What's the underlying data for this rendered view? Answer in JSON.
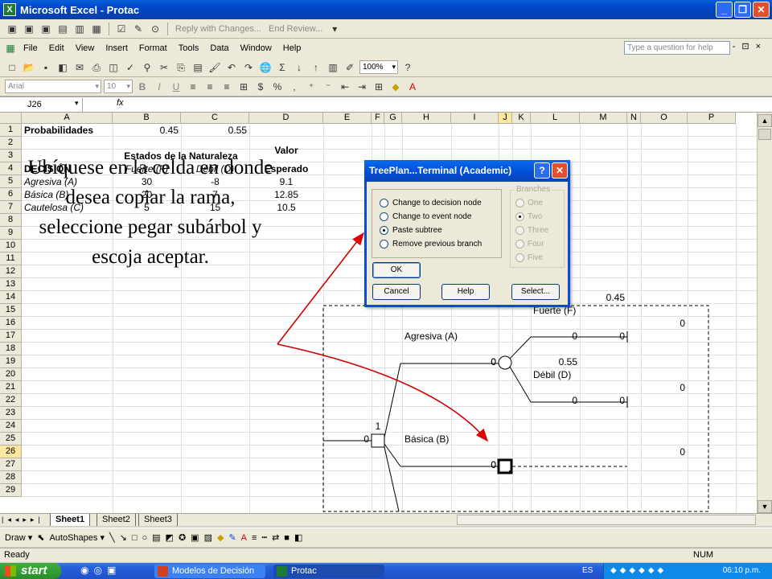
{
  "window": {
    "title": "Microsoft Excel - Protac"
  },
  "reviewing_toolbar": {
    "reply_label": "Reply with Changes...",
    "end_review_label": "End Review..."
  },
  "menu": {
    "items": [
      "File",
      "Edit",
      "View",
      "Insert",
      "Format",
      "Tools",
      "Data",
      "Window",
      "Help"
    ],
    "help_placeholder": "Type a question for help"
  },
  "standard_toolbar": {
    "zoom": "100%"
  },
  "formatting_toolbar": {
    "font": "Arial",
    "size": "10"
  },
  "formula_bar": {
    "name_box": "J26",
    "fx": "fx"
  },
  "columns": [
    "A",
    "B",
    "C",
    "D",
    "E",
    "F",
    "G",
    "H",
    "I",
    "J",
    "K",
    "L",
    "M",
    "N",
    "O",
    "P"
  ],
  "rows": [
    "1",
    "2",
    "3",
    "4",
    "5",
    "6",
    "7",
    "8",
    "9",
    "10",
    "11",
    "12",
    "13",
    "14",
    "15",
    "16",
    "17",
    "18",
    "19",
    "20",
    "21",
    "22",
    "23",
    "24",
    "25",
    "26",
    "27",
    "28",
    "29"
  ],
  "cells": {
    "a1": "Probabilidades",
    "b1": "0.45",
    "c1": "0.55",
    "b3": "Estados de la Naturaleza",
    "d3": "Valor",
    "d4": "Esperado",
    "a4": "DECISIÓN",
    "b4": "Fuerte (F)",
    "c4": "Débil (D)",
    "a5": "Agresiva (A)",
    "b5": "30",
    "c5": "-8",
    "d5": "9.1",
    "a6": "Básica (B)",
    "b6": "20",
    "c6": "7",
    "d6": "12.85",
    "a7": "Cautelosa (C)",
    "b7": "5",
    "c7": "15",
    "d7": "10.5"
  },
  "tree": {
    "l14": "0.45",
    "l15": "Fuerte (F)",
    "o16": "0",
    "h17": "Agresiva (A)",
    "l17": "0",
    "m17": "0",
    "h19": "0",
    "i19": "0",
    "l19": "0.55",
    "l20": "Débil (D)",
    "o21": "0",
    "l22": "0",
    "m22": "0",
    "node1": "1",
    "e25": "0",
    "h25": "Básica (B)",
    "o26": "0",
    "h27": "0",
    "i27": "0"
  },
  "annotation": "Ubíquese en la celda en donde desea copiar la rama, seleccione pegar subárbol y escoja aceptar.",
  "dialog": {
    "title": "TreePlan...Terminal (Academic)",
    "options": [
      "Change to decision node",
      "Change to event node",
      "Paste subtree",
      "Remove previous branch"
    ],
    "selected_option": "Paste subtree",
    "branches_label": "Branches",
    "branch_options": [
      "One",
      "Two",
      "Three",
      "Four",
      "Five"
    ],
    "ok": "OK",
    "cancel": "Cancel",
    "help": "Help",
    "select": "Select..."
  },
  "sheets": [
    "Sheet1",
    "Sheet2",
    "Sheet3"
  ],
  "draw_toolbar": {
    "draw": "Draw ▾",
    "autoshapes": "AutoShapes ▾"
  },
  "status": {
    "ready": "Ready",
    "num": "NUM"
  },
  "taskbar": {
    "start": "start",
    "tasks": [
      "Modelos de Decisión",
      "Protac"
    ],
    "lang": "ES",
    "clock": "06:10 p.m."
  }
}
